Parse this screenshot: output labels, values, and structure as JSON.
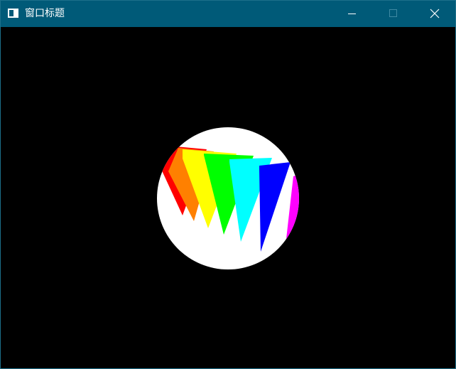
{
  "window": {
    "title": "窗口标题",
    "titlebar_color": "#005a78",
    "client_background": "#000000"
  },
  "icons": {
    "app": "window-app-icon",
    "minimize": "minimize-icon",
    "maximize": "maximize-icon",
    "close": "close-icon"
  },
  "scene": {
    "circle_color": "#ffffff",
    "wedge_colors": [
      "#ff0000",
      "#ff8000",
      "#ffff00",
      "#00ff00",
      "#00ffff",
      "#0000ff",
      "#ff00ff"
    ]
  }
}
